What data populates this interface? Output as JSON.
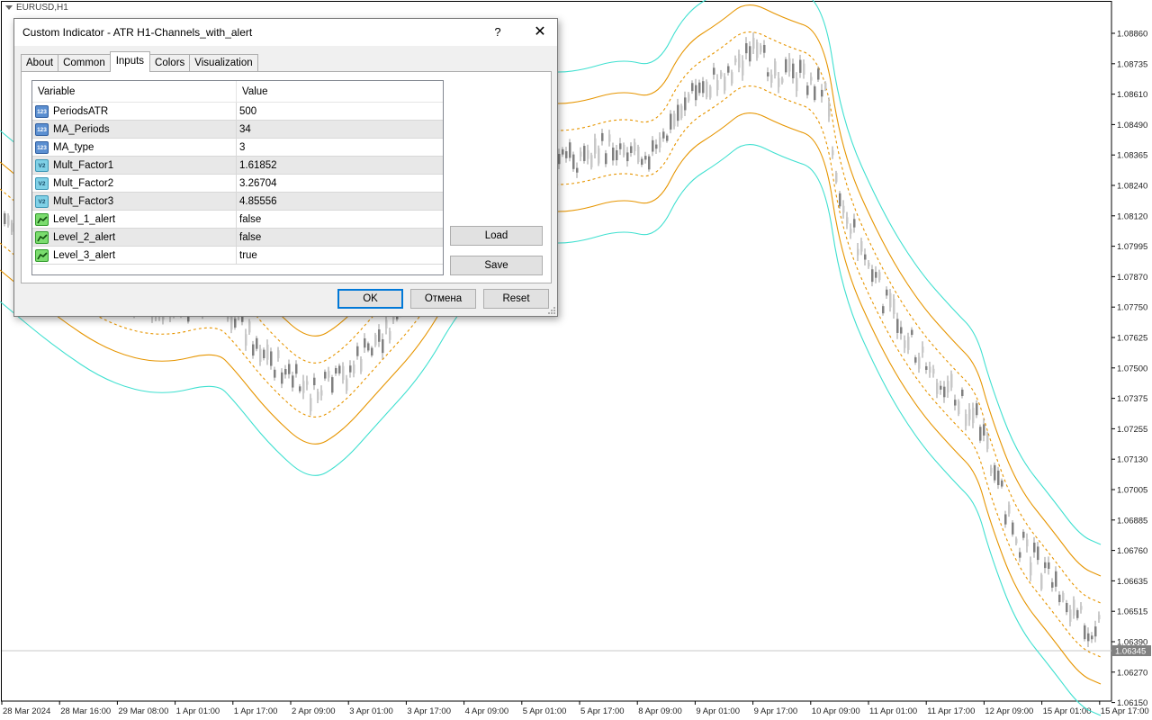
{
  "chart": {
    "title": "EURUSD,H1",
    "current_price": "1.06345",
    "price_ticks": [
      "1.08860",
      "1.08735",
      "1.08610",
      "1.08490",
      "1.08365",
      "1.08240",
      "1.08120",
      "1.07995",
      "1.07870",
      "1.07750",
      "1.07625",
      "1.07500",
      "1.07375",
      "1.07255",
      "1.07130",
      "1.07005",
      "1.06885",
      "1.06760",
      "1.06635",
      "1.06515",
      "1.06390",
      "1.06270",
      "1.06150"
    ],
    "time_ticks": [
      "28 Mar 2024",
      "28 Mar 16:00",
      "29 Mar 08:00",
      "1 Apr 01:00",
      "1 Apr 17:00",
      "2 Apr 09:00",
      "3 Apr 01:00",
      "3 Apr 17:00",
      "4 Apr 09:00",
      "5 Apr 01:00",
      "5 Apr 17:00",
      "8 Apr 09:00",
      "9 Apr 01:00",
      "9 Apr 17:00",
      "10 Apr 09:00",
      "11 Apr 01:00",
      "11 Apr 17:00",
      "12 Apr 09:00",
      "15 Apr 01:00",
      "15 Apr 17:00"
    ],
    "colors": {
      "outer_band": "#40e0d0",
      "inner_band": "#e69500",
      "candle": "#808080",
      "axis": "#000000"
    }
  },
  "dialog": {
    "title": "Custom Indicator - ATR H1-Channels_with_alert",
    "help_label": "?",
    "close_label": "✕",
    "tabs": [
      {
        "label": "About"
      },
      {
        "label": "Common"
      },
      {
        "label": "Inputs"
      },
      {
        "label": "Colors"
      },
      {
        "label": "Visualization"
      }
    ],
    "active_tab": "Inputs",
    "table": {
      "col_variable": "Variable",
      "col_value": "Value",
      "rows": [
        {
          "type": "int",
          "icon_text": "123",
          "variable": "PeriodsATR",
          "value": "500"
        },
        {
          "type": "int",
          "icon_text": "123",
          "variable": "MA_Periods",
          "value": "34"
        },
        {
          "type": "int",
          "icon_text": "123",
          "variable": "MA_type",
          "value": "3"
        },
        {
          "type": "double",
          "icon_text": "V2",
          "variable": "Mult_Factor1",
          "value": "1.61852"
        },
        {
          "type": "double",
          "icon_text": "V2",
          "variable": "Mult_Factor2",
          "value": "3.26704"
        },
        {
          "type": "double",
          "icon_text": "V2",
          "variable": "Mult_Factor3",
          "value": "4.85556"
        },
        {
          "type": "bool",
          "icon_text": "",
          "variable": "Level_1_alert",
          "value": "false"
        },
        {
          "type": "bool",
          "icon_text": "",
          "variable": "Level_2_alert",
          "value": "false"
        },
        {
          "type": "bool",
          "icon_text": "",
          "variable": "Level_3_alert",
          "value": "true"
        }
      ]
    },
    "load_label": "Load",
    "save_label": "Save",
    "ok_label": "OK",
    "cancel_label": "Отмена",
    "reset_label": "Reset"
  }
}
